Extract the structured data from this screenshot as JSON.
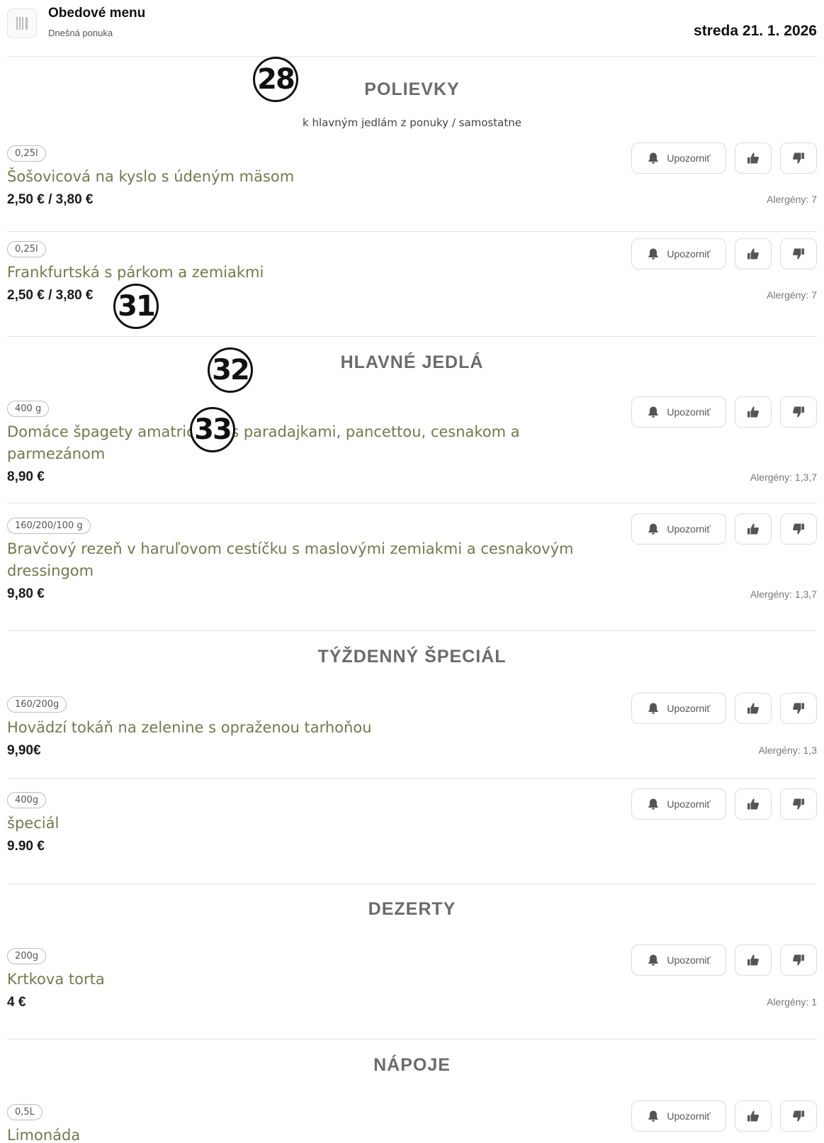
{
  "header": {
    "title": "Obedové menu",
    "subtitle": "Dnešná ponuka",
    "date": "streda 21. 1. 2026",
    "logo_icon": "cutlery-icon"
  },
  "labels": {
    "notify": "Upozorniť"
  },
  "sections": [
    {
      "title": "POLIEVKY",
      "note": "k hlavným jedlám z ponuky / samostatne",
      "items": [
        {
          "portion": "0,25l",
          "name": "Šošovicová na kyslo s údeným mäsom",
          "price": "2,50 € / 3,80 €",
          "allergens": "Alergény: 7"
        },
        {
          "portion": "0,25l",
          "name": "Frankfurtská s párkom a zemiakmi",
          "price": "2,50 € / 3,80 €",
          "allergens": "Alergény: 7"
        }
      ]
    },
    {
      "title": "HLAVNÉ JEDLÁ",
      "items": [
        {
          "portion": "400 g",
          "name": "Domáce špagety amatriciana s paradajkami, pancettou, cesnakom a parmezánom",
          "price": "8,90 €",
          "allergens": "Alergény: 1,3,7"
        },
        {
          "portion": "160/200/100 g",
          "name": "Bravčový rezeň v haruľovom cestíčku s maslovými zemiakmi a cesnakovým dressingom",
          "price": "9,80 €",
          "allergens": "Alergény: 1,3,7"
        }
      ]
    },
    {
      "title": "TÝŽDENNÝ ŠPECIÁL",
      "items": [
        {
          "portion": "160/200g",
          "name": "Hovädzí tokáň na zelenine s opraženou tarhoňou",
          "price": "9,90€",
          "allergens": "Alergény: 1,3"
        },
        {
          "portion": "400g",
          "name": "špeciál",
          "price": "9.90 €",
          "allergens": ""
        }
      ]
    },
    {
      "title": "DEZERTY",
      "items": [
        {
          "portion": "200g",
          "name": "Krtkova torta",
          "price": "4 €",
          "allergens": "Alergény: 1"
        }
      ]
    },
    {
      "title": "NÁPOJE",
      "items": [
        {
          "portion": "0,5L",
          "name": "Limonáda",
          "price": "",
          "allergens": ""
        }
      ]
    }
  ],
  "markers": [
    "28",
    "31",
    "32",
    "33"
  ]
}
